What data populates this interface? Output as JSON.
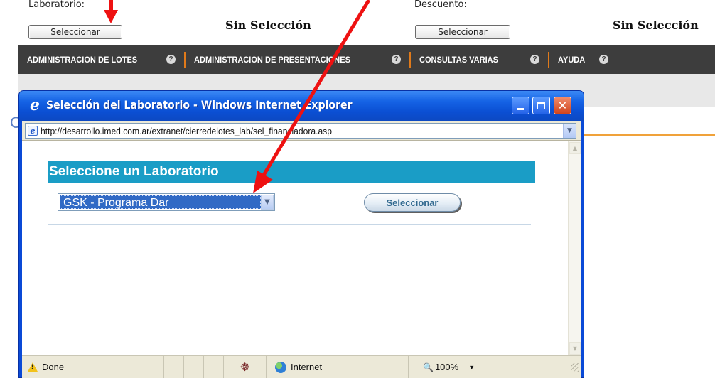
{
  "filters": {
    "lab_label": "Laboratorio:",
    "lab_button": "Seleccionar",
    "lab_value": "Sin Selección",
    "discount_label": "Descuento:",
    "discount_button": "Seleccionar",
    "discount_value": "Sin Selección"
  },
  "nav": {
    "items": [
      {
        "label": "ADMINISTRACION DE LOTES"
      },
      {
        "label": "ADMINISTRACION DE PRESENTACIONES"
      },
      {
        "label": "CONSULTAS VARIAS"
      },
      {
        "label": "AYUDA"
      }
    ],
    "help_glyph": "?",
    "separator_color": "#e07a1a"
  },
  "background_letter": "C",
  "popup": {
    "title": "Selección del Laboratorio - Windows Internet Explorer",
    "url": "http://desarrollo.imed.com.ar/extranet/cierredelotes_lab/sel_financiadora.asp",
    "section_header": "Seleccione un Laboratorio",
    "selected_lab": "GSK - Programa Dar",
    "select_button": "Seleccionar",
    "status": {
      "done_text": "Done",
      "zone_text": "Internet",
      "zoom_text": "100%"
    },
    "icons": [
      "ie-logo-icon",
      "minimize-icon",
      "maximize-icon",
      "close-icon",
      "page-icon",
      "warning-icon",
      "privacy-icon",
      "globe-icon",
      "zoom-icon"
    ]
  },
  "colors": {
    "nav_bg": "#3d3d3d",
    "ie_title_blue": "#0b4fd3",
    "section_header_bg": "#1a9dc6",
    "select_highlight": "#316ac5",
    "annotation_red": "#ee1111"
  }
}
